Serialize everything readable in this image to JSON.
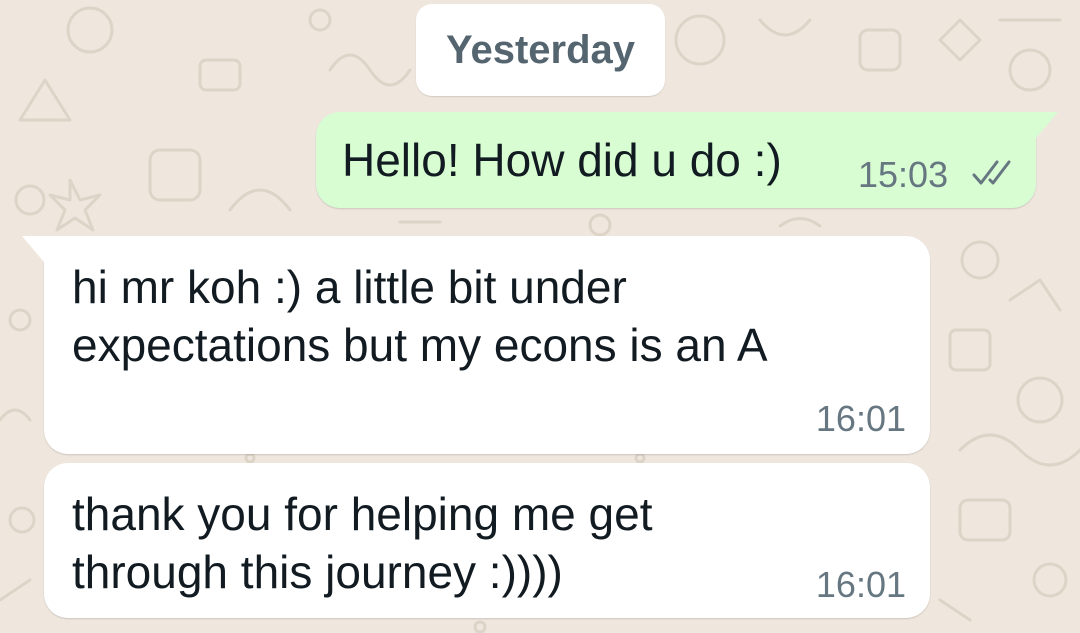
{
  "date_separator": "Yesterday",
  "messages": [
    {
      "direction": "outgoing",
      "text": "Hello! How did u do :)",
      "time": "15:03",
      "status_icon": "double-check-icon"
    },
    {
      "direction": "incoming",
      "text_lines": [
        "hi mr koh :) a little bit under",
        "expectations but my econs is an A"
      ],
      "time": "16:01"
    },
    {
      "direction": "incoming",
      "text_lines": [
        "thank you for helping me get",
        "through this journey :))))"
      ],
      "time": "16:01"
    }
  ],
  "colors": {
    "chat_background": "#efe7de",
    "wallpaper_doodle": "#ddd3c6",
    "outgoing_bubble": "#d9fdd3",
    "incoming_bubble": "#ffffff",
    "date_chip_text": "#54656f",
    "timestamp": "#667781",
    "message_text": "#111b21"
  }
}
